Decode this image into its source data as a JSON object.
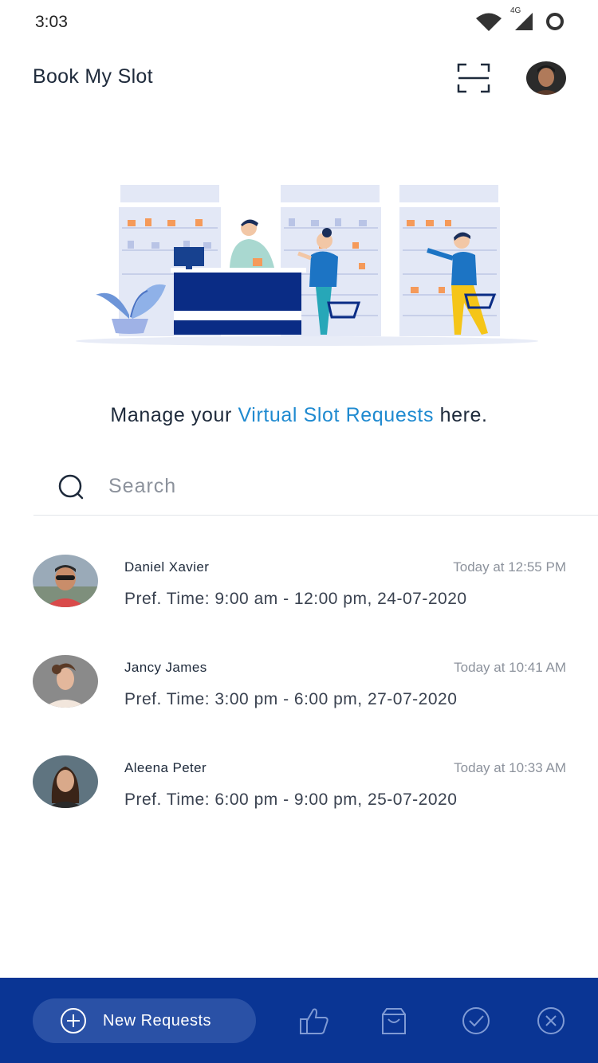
{
  "status_bar": {
    "time": "3:03",
    "network_label": "4G",
    "icons": [
      "wifi-icon",
      "cellular-signal-icon",
      "battery-ring-icon"
    ]
  },
  "header": {
    "title": "Book My Slot",
    "scan_icon": "scan-icon",
    "avatar": "profile-avatar"
  },
  "hero": {
    "illustration": "pharmacy-store-illustration"
  },
  "tagline": {
    "prefix": "Manage your ",
    "highlight": "Virtual Slot Requests",
    "suffix": " here."
  },
  "search": {
    "placeholder": "Search",
    "value": ""
  },
  "requests": [
    {
      "name": "Daniel Xavier",
      "time": "Today at 12:55 PM",
      "pref": "Pref. Time: 9:00 am - 12:00 pm, 24-07-2020"
    },
    {
      "name": "Jancy James",
      "time": "Today at 10:41 AM",
      "pref": "Pref. Time: 3:00 pm - 6:00 pm, 27-07-2020"
    },
    {
      "name": "Aleena Peter",
      "time": "Today at 10:33 AM",
      "pref": "Pref. Time: 6:00 pm - 9:00 pm, 25-07-2020"
    }
  ],
  "bottom_nav": {
    "new_requests_label": "New Requests",
    "icons": [
      "plus-circle-icon",
      "thumbs-up-icon",
      "shopping-bag-icon",
      "check-circle-icon",
      "close-circle-icon"
    ]
  },
  "colors": {
    "accent": "#1f8ad0",
    "navy": "#0a3594",
    "pill": "#2a51a6",
    "text": "#1e2a3b",
    "muted": "#8c929c"
  }
}
